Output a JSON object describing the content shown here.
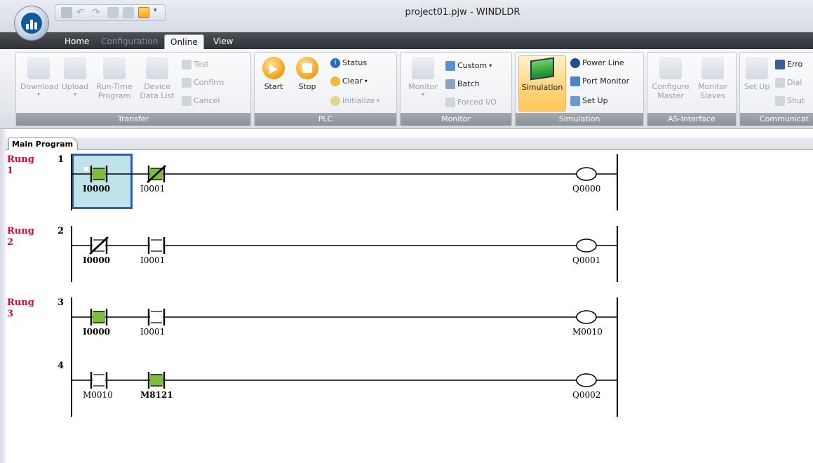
{
  "window": {
    "title": "project01.pjw - WINDLDR"
  },
  "menu_tabs": [
    {
      "label": "Home",
      "state": "normal"
    },
    {
      "label": "Configuration",
      "state": "disabled"
    },
    {
      "label": "Online",
      "state": "active"
    },
    {
      "label": "View",
      "state": "normal"
    }
  ],
  "ribbon": {
    "transfer": {
      "label": "Transfer",
      "download": "Download",
      "upload": "Upload",
      "runtime1": "Run-Time",
      "runtime2": "Program",
      "device1": "Device",
      "device2": "Data List",
      "test": "Test",
      "confirm": "Confirm",
      "cancel": "Cancel"
    },
    "plc": {
      "label": "PLC",
      "start": "Start",
      "stop": "Stop",
      "status": "Status",
      "clear": "Clear",
      "initialize": "Initialize"
    },
    "monitor": {
      "label": "Monitor",
      "monitor": "Monitor",
      "custom": "Custom",
      "batch": "Batch",
      "forced": "Forced I/O"
    },
    "simulation": {
      "label": "Simulation",
      "simulation": "Simulation",
      "power_line": "Power Line",
      "port_monitor": "Port Monitor",
      "set_up": "Set Up"
    },
    "asi": {
      "label": "AS-Interface",
      "configure1": "Configure",
      "configure2": "Master",
      "monitor1": "Monitor",
      "monitor2": "Slaves"
    },
    "comm": {
      "label": "Communicat",
      "set_up": "Set Up",
      "error": "Erro",
      "dial": "Dial",
      "shut": "Shut"
    }
  },
  "doc_tab": "Main Program",
  "colors": {
    "on": "#7cbd3c",
    "rung_label": "#c8102e",
    "cursor": "#2f5fb3",
    "cursor_fill": "#bfe3ea"
  },
  "rungs": [
    {
      "label": "Rung",
      "num": "1",
      "lines": [
        {
          "line": "1",
          "contacts": [
            {
              "op": "I0000",
              "type": "NO",
              "on": true,
              "bold": true
            },
            {
              "op": "I0001",
              "type": "NC",
              "on": true,
              "bold": false
            }
          ],
          "coil": "Q0000"
        }
      ]
    },
    {
      "label": "Rung",
      "num": "2",
      "lines": [
        {
          "line": "2",
          "contacts": [
            {
              "op": "I0000",
              "type": "NC",
              "on": false,
              "bold": true
            },
            {
              "op": "I0001",
              "type": "NO",
              "on": false,
              "bold": false
            }
          ],
          "coil": "Q0001"
        }
      ]
    },
    {
      "label": "Rung",
      "num": "3",
      "lines": [
        {
          "line": "3",
          "contacts": [
            {
              "op": "I0000",
              "type": "NO",
              "on": true,
              "bold": true
            },
            {
              "op": "I0001",
              "type": "NO",
              "on": false,
              "bold": false
            }
          ],
          "coil": "M0010"
        },
        {
          "line": "4",
          "contacts": [
            {
              "op": "M0010",
              "type": "NO",
              "on": false,
              "bold": false
            },
            {
              "op": "M8121",
              "type": "NO",
              "on": true,
              "bold": true
            }
          ],
          "coil": "Q0002"
        }
      ]
    }
  ]
}
